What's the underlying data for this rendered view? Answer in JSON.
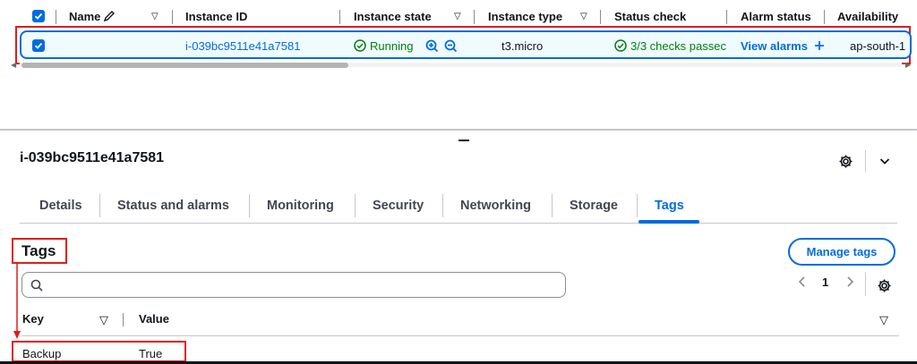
{
  "instance_table": {
    "columns": [
      {
        "label": "Name"
      },
      {
        "label": "Instance ID"
      },
      {
        "label": "Instance state"
      },
      {
        "label": "Instance type"
      },
      {
        "label": "Status check"
      },
      {
        "label": "Alarm status"
      },
      {
        "label": "Availability"
      }
    ],
    "row": {
      "selected": true,
      "instance_id": "i-039bc9511e41a7581",
      "state": "Running",
      "type": "t3.micro",
      "status_check": "3/3 checks passec",
      "alarm_link": "View alarms",
      "availability_zone": "ap-south-1"
    }
  },
  "detail": {
    "instance_id": "i-039bc9511e41a7581",
    "tabs": [
      {
        "label": "Details"
      },
      {
        "label": "Status and alarms"
      },
      {
        "label": "Monitoring"
      },
      {
        "label": "Security"
      },
      {
        "label": "Networking"
      },
      {
        "label": "Storage"
      },
      {
        "label": "Tags",
        "active": true
      }
    ]
  },
  "tags_panel": {
    "heading": "Tags",
    "manage_button": "Manage tags",
    "search": {
      "value": "",
      "placeholder": ""
    },
    "pagination": {
      "current_page": "1"
    },
    "columns": {
      "key": "Key",
      "value": "Value"
    },
    "rows": [
      {
        "key": "Backup",
        "value": "True"
      }
    ]
  },
  "colors": {
    "accent": "#006ce0",
    "success": "#037f0c",
    "highlight_box": "#e31b1b"
  },
  "icons": [
    "check-icon",
    "pencil-icon",
    "caret-down-icon",
    "check-circle-icon",
    "zoom-in-icon",
    "zoom-out-icon",
    "plus-icon",
    "gear-icon",
    "chevron-down-icon",
    "search-icon",
    "chevron-left-icon",
    "chevron-right-icon"
  ]
}
